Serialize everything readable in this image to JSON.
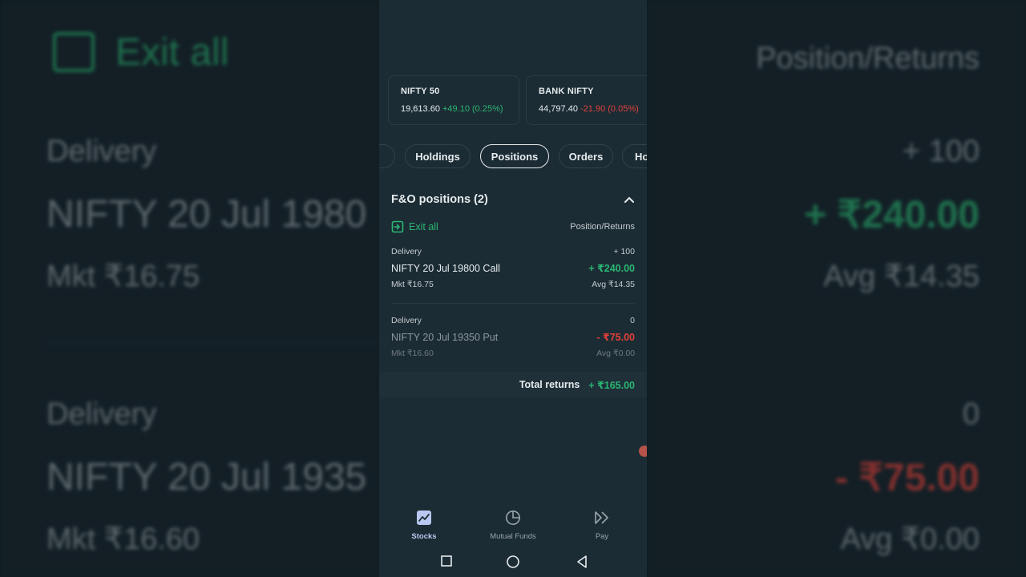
{
  "background": {
    "exit_all": "Exit all",
    "position_returns": "Position/Returns",
    "delivery_1": "Delivery",
    "qty_1": "+ 100",
    "instrument_1": "NIFTY 20 Jul 1980",
    "returns_1": "+ ₹240.00",
    "mkt_1": "Mkt ₹16.75",
    "avg_1": "Avg ₹14.35",
    "delivery_2": "Delivery",
    "qty_2": "0",
    "instrument_2": "NIFTY 20 Jul 1935",
    "returns_2": "- ₹75.00",
    "mkt_2": "Mkt ₹16.60",
    "avg_2": "Avg ₹0.00"
  },
  "indices": [
    {
      "name": "NIFTY 50",
      "value": "19,613.60",
      "change": "+49.10 (0.25%)",
      "direction": "up"
    },
    {
      "name": "BANK NIFTY",
      "value": "44,797.40",
      "change": "-21.90 (0.05%)",
      "direction": "down"
    }
  ],
  "tabs": {
    "items": [
      "Holdings",
      "Positions",
      "Orders",
      "Ho"
    ],
    "active": "Positions"
  },
  "positions_section": {
    "title": "F&O positions (2)",
    "exit_all_label": "Exit all",
    "column_header": "Position/Returns",
    "rows": [
      {
        "type": "Delivery",
        "quantity": "+ 100",
        "instrument": "NIFTY 20 Jul 19800 Call",
        "returns": "+ ₹240.00",
        "market": "Mkt ₹16.75",
        "average": "Avg ₹14.35"
      },
      {
        "type": "Delivery",
        "quantity": "0",
        "instrument": "NIFTY 20 Jul 19350 Put",
        "returns": "- ₹75.00",
        "market": "Mkt ₹16.60",
        "average": "Avg ₹0.00"
      }
    ],
    "total_label": "Total returns",
    "total_value": "+ ₹165.00"
  },
  "bottom_nav": {
    "items": [
      {
        "label": "Stocks",
        "icon": "chart-line-icon",
        "active": true
      },
      {
        "label": "Mutual Funds",
        "icon": "pie-chart-icon",
        "active": false
      },
      {
        "label": "Pay",
        "icon": "double-chevron-icon",
        "active": false
      }
    ]
  },
  "colors": {
    "positive": "#2bb673",
    "negative": "#e0413a",
    "surface": "#1c2c34",
    "active_nav": "#b8c8f0"
  }
}
